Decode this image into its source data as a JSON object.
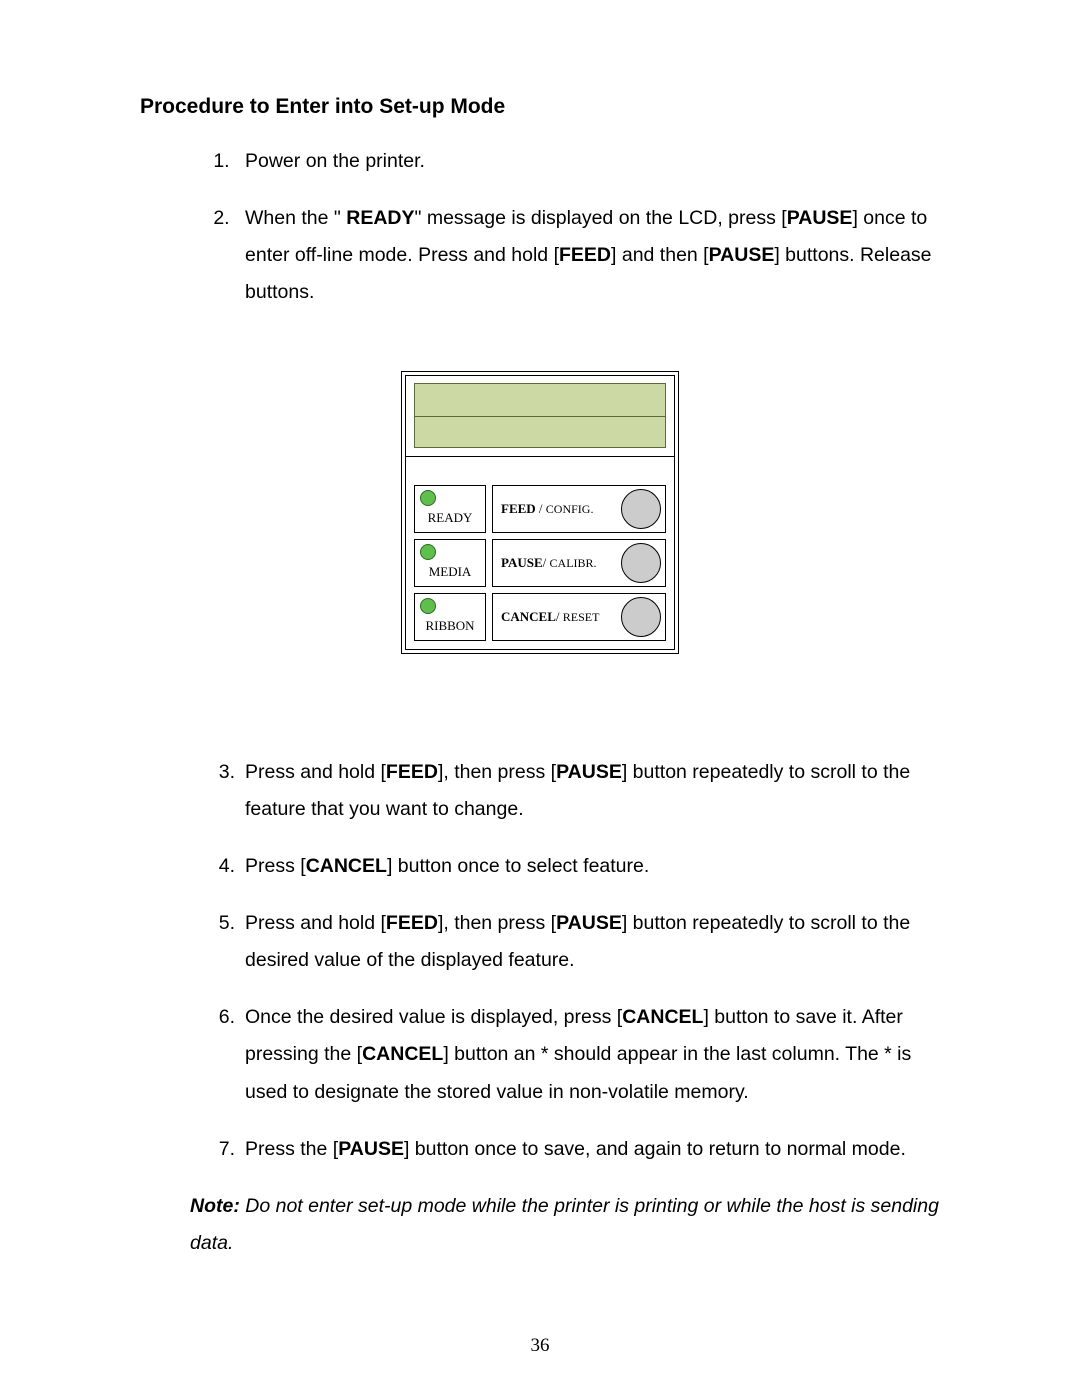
{
  "title": "Procedure to Enter into Set-up Mode",
  "steps_a": [
    "Power on the printer.",
    "When the \" <b>READY</b>\" message is displayed on the LCD, press [<b>PAUSE</b>] once to enter off-line mode. Press and hold [<b>FEED</b>] and then [<b>PAUSE</b>] buttons. Release buttons."
  ],
  "panel": {
    "leds": [
      "READY",
      "MEDIA",
      "RIBBON"
    ],
    "buttons": [
      {
        "bold": "FEED",
        "sep": " / ",
        "small": "CONFIG."
      },
      {
        "bold": "PAUSE",
        "sep": "/ ",
        "small": "CALIBR."
      },
      {
        "bold": "CANCEL",
        "sep": "/ ",
        "small": "RESET"
      }
    ]
  },
  "steps_b": [
    "Press and hold [<b>FEED</b>], then press [<b>PAUSE</b>] button repeatedly to scroll to the feature that you want to change.",
    "Press [<b>CANCEL</b>] button once to select feature.",
    "Press and hold [<b>FEED</b>], then press [<b>PAUSE</b>] button repeatedly to scroll to the desired value of the displayed feature.",
    "Once the desired value is displayed, press [<b>CANCEL</b>] button to save it. After pressing the [<b>CANCEL</b>] button an * should appear in the last column. The * is used to designate the stored value in non-volatile memory.",
    "Press the [<b>PAUSE</b>] button once to save, and again to return to normal mode."
  ],
  "note_label": "Note:",
  "note_text": "Do not enter set-up mode while the printer is printing or while the host is sending data.",
  "page_number": "36"
}
